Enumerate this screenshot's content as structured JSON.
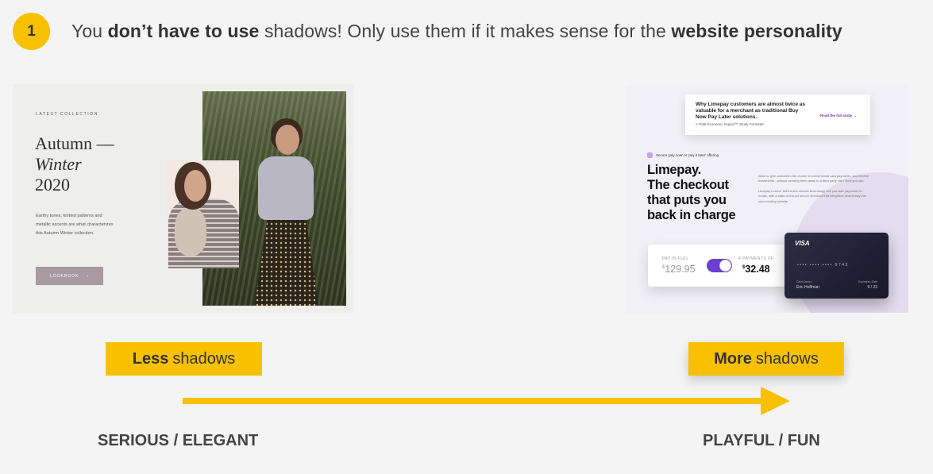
{
  "badge": "1",
  "headline": {
    "p1": "You ",
    "b1": "don’t have to use",
    "p2": " shadows! Only use them if it makes sense for the ",
    "b2": "website personality"
  },
  "left_example": {
    "eyebrow": "LATEST COLLECTION",
    "title_l1": "Autumn —",
    "title_l2": "Winter",
    "title_l3": "2020",
    "desc": "Earthy tones, knitted patterns and metallic accents are what characterizes this Autumn Winter collection.",
    "button": "LOOKBOOK",
    "button_arrow": "›"
  },
  "right_example": {
    "banner_title": "Why Limepay customers are almost twice as valuable for a merchant as traditional Buy Now Pay Later solutions.",
    "banner_sub": "A Total Economic Impact™ Study Forrester",
    "banner_link": "Read the full study →",
    "eyebrow": "Secure 'pay now' or 'pay it later' offering",
    "title_l1": "Limepay.",
    "title_l2": "The checkout",
    "title_l3": "that puts you",
    "title_l4": "back in charge",
    "para1": "Want to give customers the choice of conventional card payments, and flexible instalments - without sending them away to a third party site? Now you can.",
    "para2": "Limepay's clever behind-the-scenes technology lets you take payments in-house, with a state-of-the-art secure checkout that integrates seamlessly into your existing website.",
    "pay_label1": "PAY IN FULL",
    "pay_currency1": "$",
    "pay_value1": "129.95",
    "pay_label2": "4 PAYMENTS OF",
    "pay_currency2": "$",
    "pay_value2": "32.48",
    "visa_logo": "VISA",
    "visa_number": "••••    ••••    ••••    9743",
    "visa_holder_label": "Card Owner",
    "visa_holder": "Eric Hoffman",
    "visa_exp_label": "Expiration Date",
    "visa_exp": "9 / 22"
  },
  "labels": {
    "less_bold": "Less",
    "less_rest": "shadows",
    "more_bold": "More",
    "more_rest": "shadows"
  },
  "captions": {
    "left": "SERIOUS / ELEGANT",
    "right": "PLAYFUL / FUN"
  },
  "colors": {
    "accent": "#f7c100",
    "purple": "#6b3fd0",
    "background": "#f4f4f4"
  }
}
